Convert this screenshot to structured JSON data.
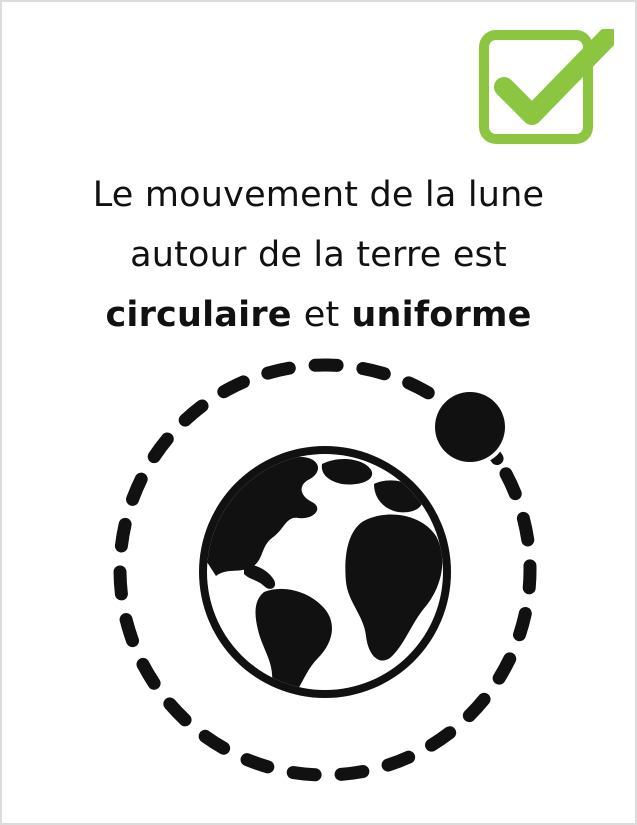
{
  "statement": {
    "line1": "Le mouvement de la lune",
    "line2": "autour de la terre est",
    "keyword1": "circulaire",
    "connector": "et",
    "keyword2": "uniforme"
  },
  "icons": {
    "badge": "checkmark-icon",
    "planet": "earth-globe-icon",
    "satellite": "moon-icon",
    "path": "dashed-orbit-icon"
  },
  "colors": {
    "accent": "#8cc540",
    "ink": "#111111",
    "background": "#ffffff"
  }
}
